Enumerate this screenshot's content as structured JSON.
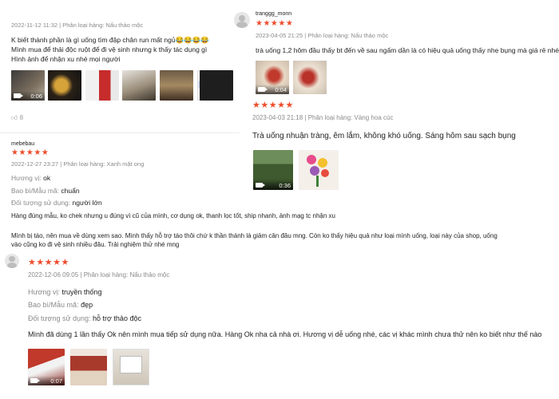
{
  "review_top_left": {
    "meta": "2022-11-12 11:32 | Phân loại hàng: Nấu thảo mộc",
    "lines": [
      "K biết thành phần là gì uống tìm đập chân run mất ngủ😂😂😂😂",
      "Mình mua để thải độc ruột để đi vệ sinh nhưng k thấy tác dụng gì",
      "Hình ảnh để nhận xu nhé mọi người"
    ],
    "video_duration": "0:06",
    "like_count": "8",
    "icons": {
      "like": "thumbs-up-icon",
      "video": "video-camera-icon"
    }
  },
  "review_right_1": {
    "username": "tranggg_monn",
    "stars": "★★★★★",
    "meta": "2023-04-05 21:25 | Phân loại hàng: Nấu thảo mộc",
    "text": "trà uống 1,2 hôm đầu thấy bt đến về sau ngấm dần là có hiệu quả uống thấy nhẹ bụng mà giá rẻ nhé a",
    "video_duration": "0:04"
  },
  "review_right_2": {
    "stars": "★★★★★",
    "meta": "2023-04-03 21:18 | Phân loại hàng: Vàng hoa cúc",
    "text": "Trà uống nhuận tràng, êm lắm, không khó uống. Sáng hôm sau sạch bụng",
    "video_duration": "0:36"
  },
  "review_mid": {
    "username": "mebebau",
    "stars": "★★★★★",
    "meta": "2022-12-27 23:27 | Phân loại hàng: Xanh mặt ong",
    "attrs": [
      {
        "key": "Hương vị:",
        "value": "ok"
      },
      {
        "key": "Bao bì/Mẫu mã:",
        "value": "chuẩn"
      },
      {
        "key": "Đối tượng sử dụng:",
        "value": "người lớn"
      }
    ],
    "line1": "Hàng đúng mẫu, ko chek nhưng u đúng vì cũ của mình, cơ dụng ok, thanh lọc tốt, ship nhanh, ảnh mạg tc nhận xu",
    "line2": "Mình bị táo, nên mua về dùng xem sao. Mình thấy hỗ trợ táo thôi chứ k thần thánh là giảm cân đâu mng. Còn ko thấy hiệu quả như loại mình uống, loại này của shop, uống",
    "line3": "vào cũng ko đi vệ sinh nhiều đâu. Trải nghiệm thử nhé mng"
  },
  "review_bottom": {
    "stars": "★★★★★",
    "meta": "2022-12-06 09:05 | Phân loại hàng: Nấu thảo mộc",
    "attrs": [
      {
        "key": "Hương vị:",
        "value": "truyền thống"
      },
      {
        "key": "Bao bì/Mẫu mã:",
        "value": "đẹp"
      },
      {
        "key": "Đối tượng sử dụng:",
        "value": "hỗ trợ thảo độc"
      }
    ],
    "text": "Mình đã dùng 1 lần thấy Ok nên mình mua tiếp sử dụng nữa. Hàng Ok nha cả nhà ơi. Hương vị dễ uống nhé, các vị khác mình chưa thử nên ko biết như thế nào",
    "video_duration": "0:07"
  },
  "colors": {
    "star": "#ee4d2d",
    "meta": "#8a8a8a",
    "text": "#222222"
  }
}
